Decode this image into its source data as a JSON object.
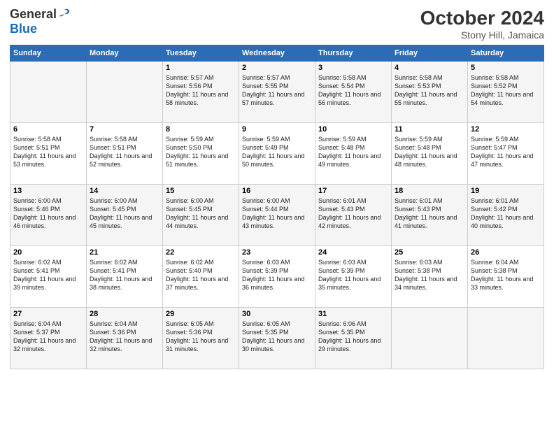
{
  "logo": {
    "general": "General",
    "blue": "Blue"
  },
  "header": {
    "month": "October 2024",
    "location": "Stony Hill, Jamaica"
  },
  "weekdays": [
    "Sunday",
    "Monday",
    "Tuesday",
    "Wednesday",
    "Thursday",
    "Friday",
    "Saturday"
  ],
  "weeks": [
    [
      {
        "day": "",
        "sunrise": "",
        "sunset": "",
        "daylight": ""
      },
      {
        "day": "",
        "sunrise": "",
        "sunset": "",
        "daylight": ""
      },
      {
        "day": "1",
        "sunrise": "Sunrise: 5:57 AM",
        "sunset": "Sunset: 5:56 PM",
        "daylight": "Daylight: 11 hours and 58 minutes."
      },
      {
        "day": "2",
        "sunrise": "Sunrise: 5:57 AM",
        "sunset": "Sunset: 5:55 PM",
        "daylight": "Daylight: 11 hours and 57 minutes."
      },
      {
        "day": "3",
        "sunrise": "Sunrise: 5:58 AM",
        "sunset": "Sunset: 5:54 PM",
        "daylight": "Daylight: 11 hours and 56 minutes."
      },
      {
        "day": "4",
        "sunrise": "Sunrise: 5:58 AM",
        "sunset": "Sunset: 5:53 PM",
        "daylight": "Daylight: 11 hours and 55 minutes."
      },
      {
        "day": "5",
        "sunrise": "Sunrise: 5:58 AM",
        "sunset": "Sunset: 5:52 PM",
        "daylight": "Daylight: 11 hours and 54 minutes."
      }
    ],
    [
      {
        "day": "6",
        "sunrise": "Sunrise: 5:58 AM",
        "sunset": "Sunset: 5:51 PM",
        "daylight": "Daylight: 11 hours and 53 minutes."
      },
      {
        "day": "7",
        "sunrise": "Sunrise: 5:58 AM",
        "sunset": "Sunset: 5:51 PM",
        "daylight": "Daylight: 11 hours and 52 minutes."
      },
      {
        "day": "8",
        "sunrise": "Sunrise: 5:59 AM",
        "sunset": "Sunset: 5:50 PM",
        "daylight": "Daylight: 11 hours and 51 minutes."
      },
      {
        "day": "9",
        "sunrise": "Sunrise: 5:59 AM",
        "sunset": "Sunset: 5:49 PM",
        "daylight": "Daylight: 11 hours and 50 minutes."
      },
      {
        "day": "10",
        "sunrise": "Sunrise: 5:59 AM",
        "sunset": "Sunset: 5:48 PM",
        "daylight": "Daylight: 11 hours and 49 minutes."
      },
      {
        "day": "11",
        "sunrise": "Sunrise: 5:59 AM",
        "sunset": "Sunset: 5:48 PM",
        "daylight": "Daylight: 11 hours and 48 minutes."
      },
      {
        "day": "12",
        "sunrise": "Sunrise: 5:59 AM",
        "sunset": "Sunset: 5:47 PM",
        "daylight": "Daylight: 11 hours and 47 minutes."
      }
    ],
    [
      {
        "day": "13",
        "sunrise": "Sunrise: 6:00 AM",
        "sunset": "Sunset: 5:46 PM",
        "daylight": "Daylight: 11 hours and 46 minutes."
      },
      {
        "day": "14",
        "sunrise": "Sunrise: 6:00 AM",
        "sunset": "Sunset: 5:45 PM",
        "daylight": "Daylight: 11 hours and 45 minutes."
      },
      {
        "day": "15",
        "sunrise": "Sunrise: 6:00 AM",
        "sunset": "Sunset: 5:45 PM",
        "daylight": "Daylight: 11 hours and 44 minutes."
      },
      {
        "day": "16",
        "sunrise": "Sunrise: 6:00 AM",
        "sunset": "Sunset: 5:44 PM",
        "daylight": "Daylight: 11 hours and 43 minutes."
      },
      {
        "day": "17",
        "sunrise": "Sunrise: 6:01 AM",
        "sunset": "Sunset: 5:43 PM",
        "daylight": "Daylight: 11 hours and 42 minutes."
      },
      {
        "day": "18",
        "sunrise": "Sunrise: 6:01 AM",
        "sunset": "Sunset: 5:43 PM",
        "daylight": "Daylight: 11 hours and 41 minutes."
      },
      {
        "day": "19",
        "sunrise": "Sunrise: 6:01 AM",
        "sunset": "Sunset: 5:42 PM",
        "daylight": "Daylight: 11 hours and 40 minutes."
      }
    ],
    [
      {
        "day": "20",
        "sunrise": "Sunrise: 6:02 AM",
        "sunset": "Sunset: 5:41 PM",
        "daylight": "Daylight: 11 hours and 39 minutes."
      },
      {
        "day": "21",
        "sunrise": "Sunrise: 6:02 AM",
        "sunset": "Sunset: 5:41 PM",
        "daylight": "Daylight: 11 hours and 38 minutes."
      },
      {
        "day": "22",
        "sunrise": "Sunrise: 6:02 AM",
        "sunset": "Sunset: 5:40 PM",
        "daylight": "Daylight: 11 hours and 37 minutes."
      },
      {
        "day": "23",
        "sunrise": "Sunrise: 6:03 AM",
        "sunset": "Sunset: 5:39 PM",
        "daylight": "Daylight: 11 hours and 36 minutes."
      },
      {
        "day": "24",
        "sunrise": "Sunrise: 6:03 AM",
        "sunset": "Sunset: 5:39 PM",
        "daylight": "Daylight: 11 hours and 35 minutes."
      },
      {
        "day": "25",
        "sunrise": "Sunrise: 6:03 AM",
        "sunset": "Sunset: 5:38 PM",
        "daylight": "Daylight: 11 hours and 34 minutes."
      },
      {
        "day": "26",
        "sunrise": "Sunrise: 6:04 AM",
        "sunset": "Sunset: 5:38 PM",
        "daylight": "Daylight: 11 hours and 33 minutes."
      }
    ],
    [
      {
        "day": "27",
        "sunrise": "Sunrise: 6:04 AM",
        "sunset": "Sunset: 5:37 PM",
        "daylight": "Daylight: 11 hours and 32 minutes."
      },
      {
        "day": "28",
        "sunrise": "Sunrise: 6:04 AM",
        "sunset": "Sunset: 5:36 PM",
        "daylight": "Daylight: 11 hours and 32 minutes."
      },
      {
        "day": "29",
        "sunrise": "Sunrise: 6:05 AM",
        "sunset": "Sunset: 5:36 PM",
        "daylight": "Daylight: 11 hours and 31 minutes."
      },
      {
        "day": "30",
        "sunrise": "Sunrise: 6:05 AM",
        "sunset": "Sunset: 5:35 PM",
        "daylight": "Daylight: 11 hours and 30 minutes."
      },
      {
        "day": "31",
        "sunrise": "Sunrise: 6:06 AM",
        "sunset": "Sunset: 5:35 PM",
        "daylight": "Daylight: 11 hours and 29 minutes."
      },
      {
        "day": "",
        "sunrise": "",
        "sunset": "",
        "daylight": ""
      },
      {
        "day": "",
        "sunrise": "",
        "sunset": "",
        "daylight": ""
      }
    ]
  ]
}
